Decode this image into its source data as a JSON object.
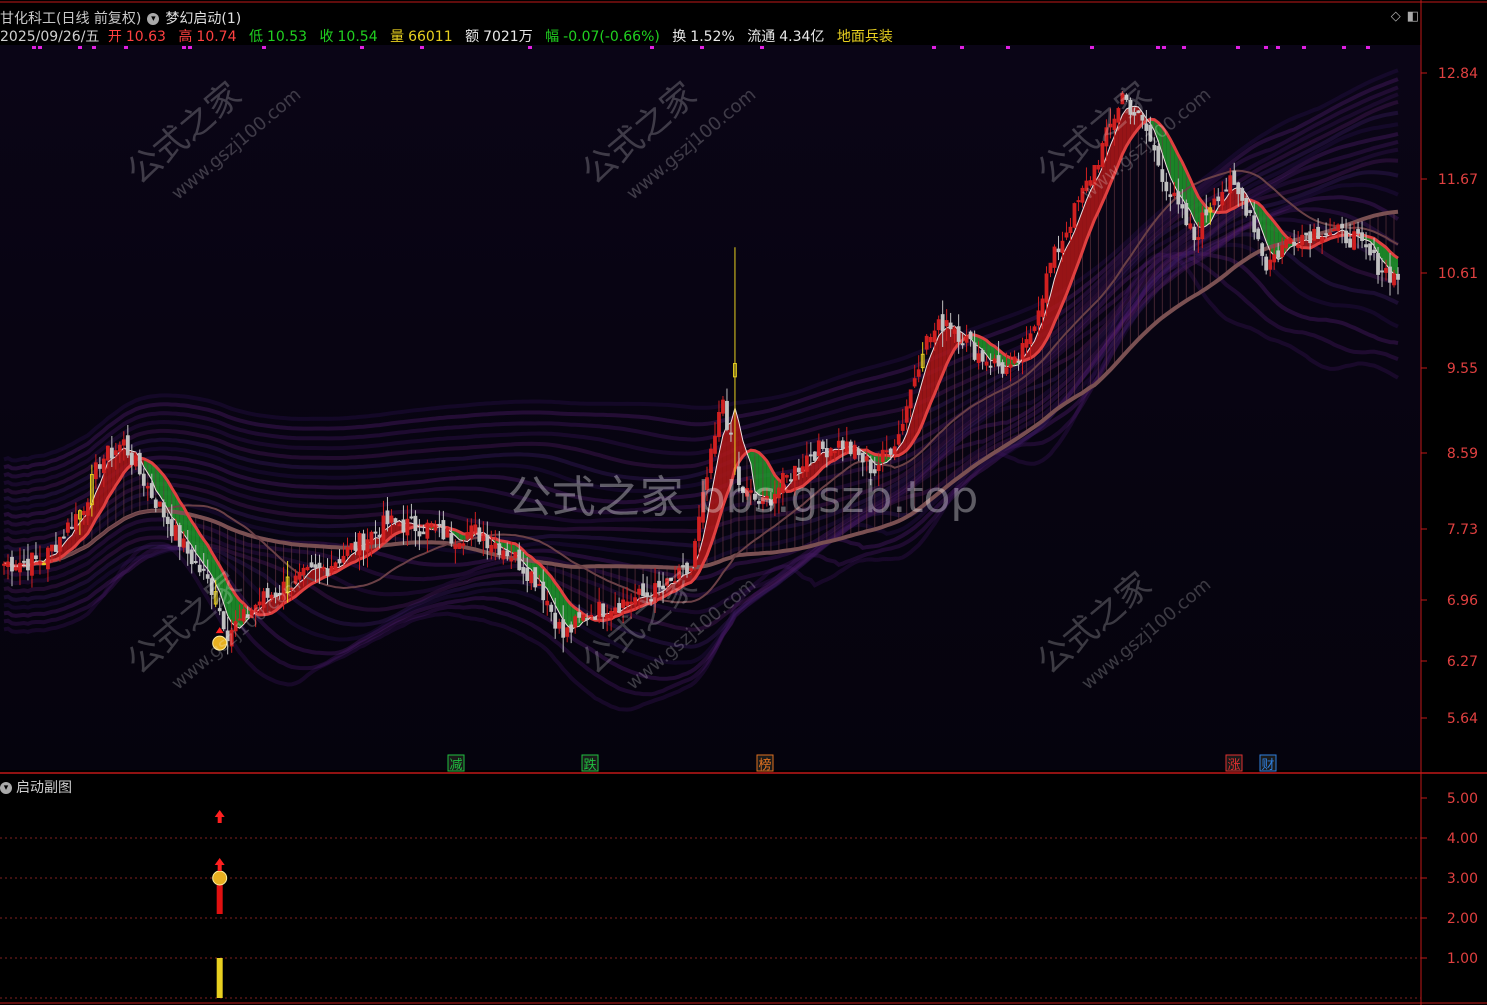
{
  "header": {
    "stock_name": "甘化科工(日线 前复权)",
    "indicator_name": "梦幻启动(1)"
  },
  "info": {
    "date": "2025/09/26/五",
    "open_label": "开",
    "open": "10.63",
    "high_label": "高",
    "high": "10.74",
    "low_label": "低",
    "low": "10.53",
    "close_label": "收",
    "close": "10.54",
    "volume_label": "量",
    "volume": "66011",
    "amount_label": "额",
    "amount": "7021万",
    "change_label": "幅",
    "change": "-0.07(-0.66%)",
    "turnover_label": "换",
    "turnover": "1.52%",
    "float_label": "流通",
    "float": "4.34亿",
    "concept": "地面兵装"
  },
  "watermarks": {
    "center": "公式之家 bbs.gszb.top",
    "tile_cn": "公式之家",
    "tile_url": "www.gszj100.com"
  },
  "event_markers": [
    {
      "label": "减",
      "color": "#20c040"
    },
    {
      "label": "跌",
      "color": "#20c040"
    },
    {
      "label": "榜",
      "color": "#e07020"
    },
    {
      "label": "涨",
      "color": "#e03030"
    },
    {
      "label": "财",
      "color": "#3080e0"
    }
  ],
  "sub_panel": {
    "title": "启动副图"
  },
  "colors": {
    "up": "#d02020",
    "down": "#c0c0c0",
    "highlight": "#e8d020",
    "ribbon_up": "#b01818",
    "ribbon_down": "#1f9a2a",
    "axis": "#c01818"
  },
  "chart_data": [
    {
      "type": "candlestick",
      "title": "",
      "ylim": [
        5.3,
        13.2
      ],
      "y_ticks": [
        "12.84",
        "11.67",
        "10.61",
        "9.55",
        "8.59",
        "7.73",
        "6.96",
        "6.27",
        "5.64"
      ],
      "y_tick_values": [
        12.84,
        11.67,
        10.61,
        9.55,
        8.59,
        7.73,
        6.96,
        6.27,
        5.64
      ],
      "bar_count": 200,
      "close_anchors": [
        [
          0,
          7.35
        ],
        [
          10,
          7.4
        ],
        [
          20,
          8.0
        ],
        [
          24,
          8.5
        ],
        [
          30,
          8.7
        ],
        [
          36,
          8.2
        ],
        [
          44,
          7.6
        ],
        [
          52,
          7.1
        ],
        [
          56,
          6.6
        ],
        [
          60,
          6.75
        ],
        [
          64,
          6.95
        ],
        [
          70,
          7.1
        ],
        [
          80,
          7.3
        ],
        [
          88,
          7.55
        ],
        [
          96,
          7.8
        ],
        [
          106,
          7.75
        ],
        [
          112,
          7.65
        ],
        [
          118,
          7.7
        ],
        [
          126,
          7.5
        ],
        [
          134,
          7.15
        ],
        [
          140,
          6.55
        ],
        [
          146,
          6.8
        ],
        [
          152,
          6.9
        ],
        [
          160,
          7.0
        ],
        [
          166,
          7.1
        ],
        [
          172,
          7.3
        ],
        [
          176,
          8.3
        ],
        [
          180,
          9.2
        ],
        [
          184,
          8.2
        ],
        [
          190,
          8.0
        ],
        [
          196,
          8.3
        ],
        [
          202,
          8.6
        ],
        [
          210,
          8.7
        ],
        [
          218,
          8.4
        ],
        [
          224,
          8.8
        ],
        [
          230,
          9.8
        ],
        [
          236,
          10.1
        ],
        [
          244,
          9.7
        ],
        [
          252,
          9.5
        ],
        [
          256,
          9.8
        ],
        [
          262,
          10.7
        ],
        [
          268,
          11.3
        ],
        [
          274,
          11.9
        ],
        [
          280,
          12.6
        ],
        [
          286,
          12.2
        ],
        [
          292,
          11.5
        ],
        [
          298,
          11.0
        ],
        [
          303,
          11.5
        ],
        [
          307,
          11.6
        ],
        [
          312,
          11.3
        ],
        [
          316,
          10.7
        ],
        [
          322,
          11.0
        ],
        [
          330,
          11.1
        ],
        [
          338,
          11.0
        ],
        [
          344,
          10.7
        ],
        [
          349,
          10.54
        ]
      ],
      "highlight_bars": [
        10,
        19,
        22,
        53,
        71,
        183,
        230,
        302
      ],
      "buy_signal_bar": 54
    },
    {
      "type": "bar",
      "title": "",
      "ylim": [
        0.5,
        5.5
      ],
      "y_ticks": [
        "5.00",
        "4.00",
        "3.00",
        "2.00",
        "1.00"
      ],
      "y_tick_values": [
        5.0,
        4.0,
        3.0,
        2.0,
        1.0
      ],
      "signals": [
        {
          "bar": 54,
          "yellow_bar": 1.0,
          "red_bar": 3.0,
          "coin_level": 3.0,
          "arrow_levels": [
            3.5,
            4.7
          ]
        }
      ]
    }
  ]
}
